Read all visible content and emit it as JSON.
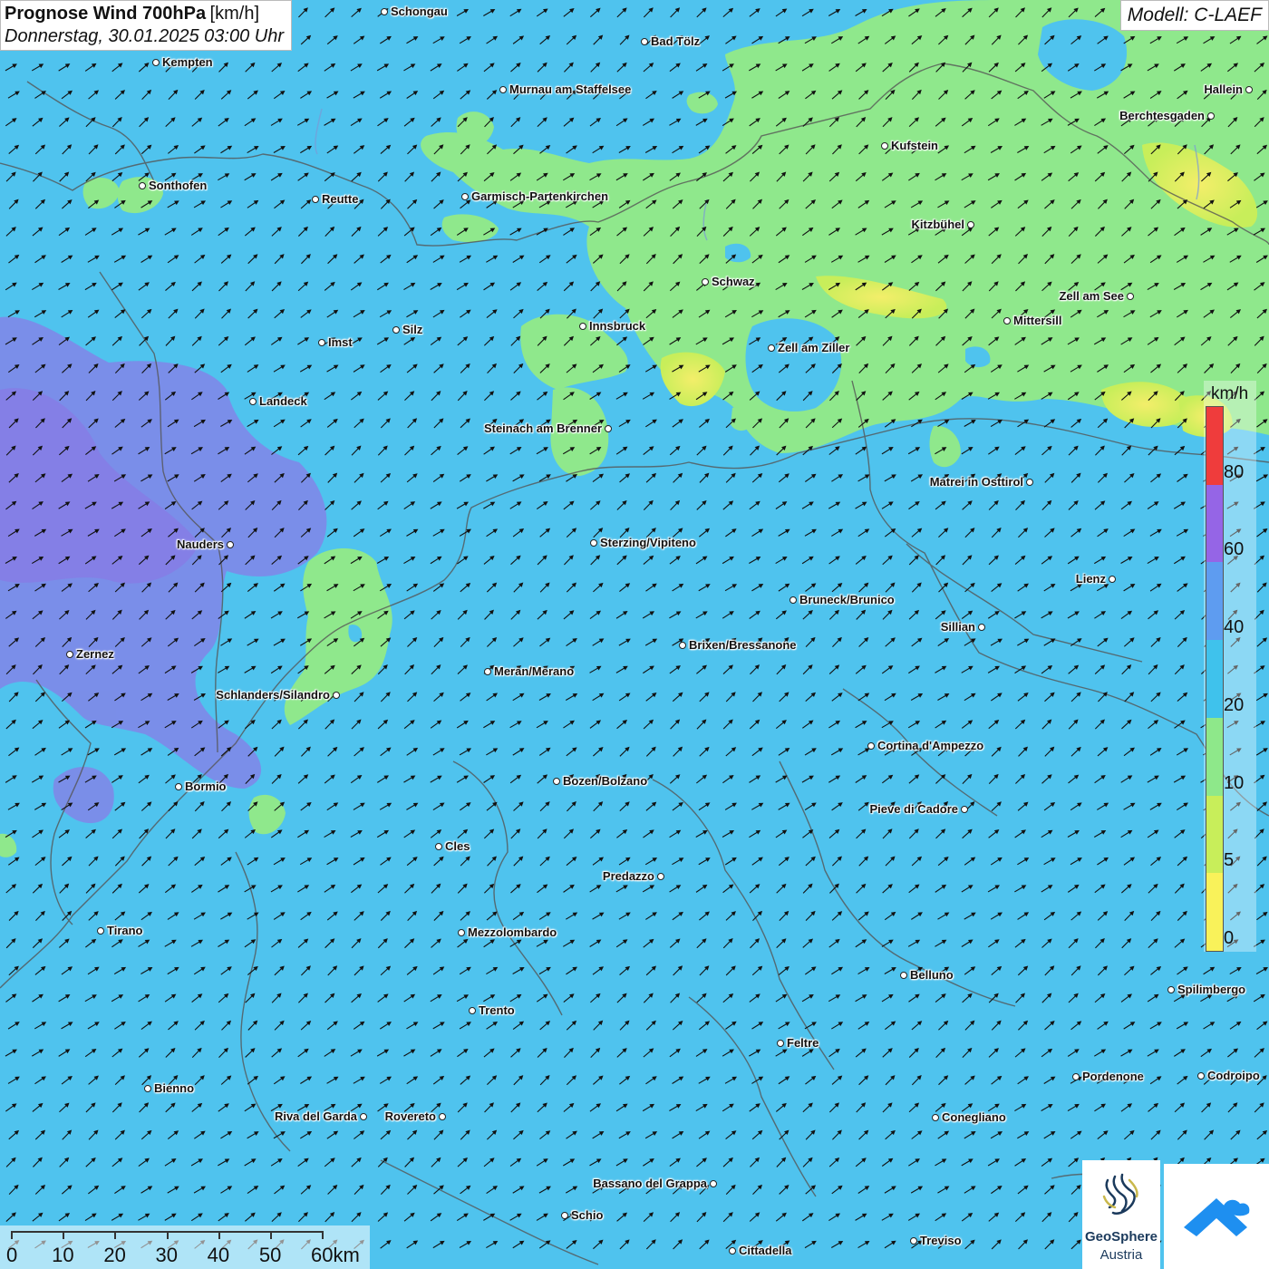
{
  "header": {
    "title": "Prognose Wind 700hPa",
    "unit": "[km/h]",
    "datetime": "Donnerstag, 30.01.2025 03:00 Uhr"
  },
  "model_label": "Modell: C-LAEF",
  "legend": {
    "unit": "km/h",
    "classes": [
      {
        "label": "0",
        "color": "#f9f25a"
      },
      {
        "label": "5",
        "color": "#c8ee5a"
      },
      {
        "label": "10",
        "color": "#8ee88a"
      },
      {
        "label": "20",
        "color": "#3fc2ec"
      },
      {
        "label": "40",
        "color": "#5e9cf0"
      },
      {
        "label": "60",
        "color": "#9565e6"
      },
      {
        "label": "80",
        "color": "#ef3c3c"
      }
    ]
  },
  "scale_bar": {
    "labels": [
      "0",
      "10",
      "20",
      "30",
      "40",
      "50",
      "60km"
    ]
  },
  "wind": {
    "prevailing_direction": "southwest",
    "arrow_color": "#111111"
  },
  "logos": {
    "geosphere_name": "GeoSphere",
    "geosphere_sub": "Austria"
  },
  "cities": [
    {
      "name": "Schongau",
      "side": "r"
    },
    {
      "name": "Bad Tölz",
      "side": "r"
    },
    {
      "name": "Kempten",
      "side": "r"
    },
    {
      "name": "Murnau am Staffelsee",
      "side": "r"
    },
    {
      "name": "Hallein",
      "side": "l"
    },
    {
      "name": "Berchtesgaden",
      "side": "l"
    },
    {
      "name": "Kufstein",
      "side": "r"
    },
    {
      "name": "Sonthofen",
      "side": "r"
    },
    {
      "name": "Reutte",
      "side": "r"
    },
    {
      "name": "Garmisch-Partenkirchen",
      "side": "r"
    },
    {
      "name": "Kitzbühel",
      "side": "l"
    },
    {
      "name": "Schwaz",
      "side": "r"
    },
    {
      "name": "Zell am See",
      "side": "l"
    },
    {
      "name": "Innsbruck",
      "side": "r"
    },
    {
      "name": "Mittersill",
      "side": "r"
    },
    {
      "name": "Silz",
      "side": "r"
    },
    {
      "name": "Imst",
      "side": "r"
    },
    {
      "name": "Zell am Ziller",
      "side": "r"
    },
    {
      "name": "Landeck",
      "side": "r"
    },
    {
      "name": "Steinach am Brenner",
      "side": "l"
    },
    {
      "name": "Matrei in Osttirol",
      "side": "l"
    },
    {
      "name": "Nauders",
      "side": "l"
    },
    {
      "name": "Sterzing/Vipiteno",
      "side": "r"
    },
    {
      "name": "Lienz",
      "side": "l"
    },
    {
      "name": "Bruneck/Brunico",
      "side": "r"
    },
    {
      "name": "Sillian",
      "side": "l"
    },
    {
      "name": "Brixen/Bressanone",
      "side": "r"
    },
    {
      "name": "Zernez",
      "side": "r"
    },
    {
      "name": "Meran/Merano",
      "side": "r"
    },
    {
      "name": "Schlanders/Silandro",
      "side": "l"
    },
    {
      "name": "Cortina d'Ampezzo",
      "side": "r"
    },
    {
      "name": "Bozen/Bolzano",
      "side": "r"
    },
    {
      "name": "Bormio",
      "side": "r"
    },
    {
      "name": "Pieve di Cadore",
      "side": "l"
    },
    {
      "name": "Cles",
      "side": "r"
    },
    {
      "name": "Predazzo",
      "side": "l"
    },
    {
      "name": "Tirano",
      "side": "r"
    },
    {
      "name": "Mezzolombardo",
      "side": "r"
    },
    {
      "name": "Belluno",
      "side": "r"
    },
    {
      "name": "Spilimbergo",
      "side": "r"
    },
    {
      "name": "Trento",
      "side": "r"
    },
    {
      "name": "Feltre",
      "side": "r"
    },
    {
      "name": "Pordenone",
      "side": "r"
    },
    {
      "name": "Codroipo",
      "side": "r"
    },
    {
      "name": "Bienno",
      "side": "r"
    },
    {
      "name": "Riva del Garda",
      "side": "l"
    },
    {
      "name": "Rovereto",
      "side": "l"
    },
    {
      "name": "Conegliano",
      "side": "r"
    },
    {
      "name": "Bassano del Grappa",
      "side": "l"
    },
    {
      "name": "Schio",
      "side": "r"
    },
    {
      "name": "Treviso",
      "side": "r"
    },
    {
      "name": "Cittadella",
      "side": "r"
    }
  ]
}
